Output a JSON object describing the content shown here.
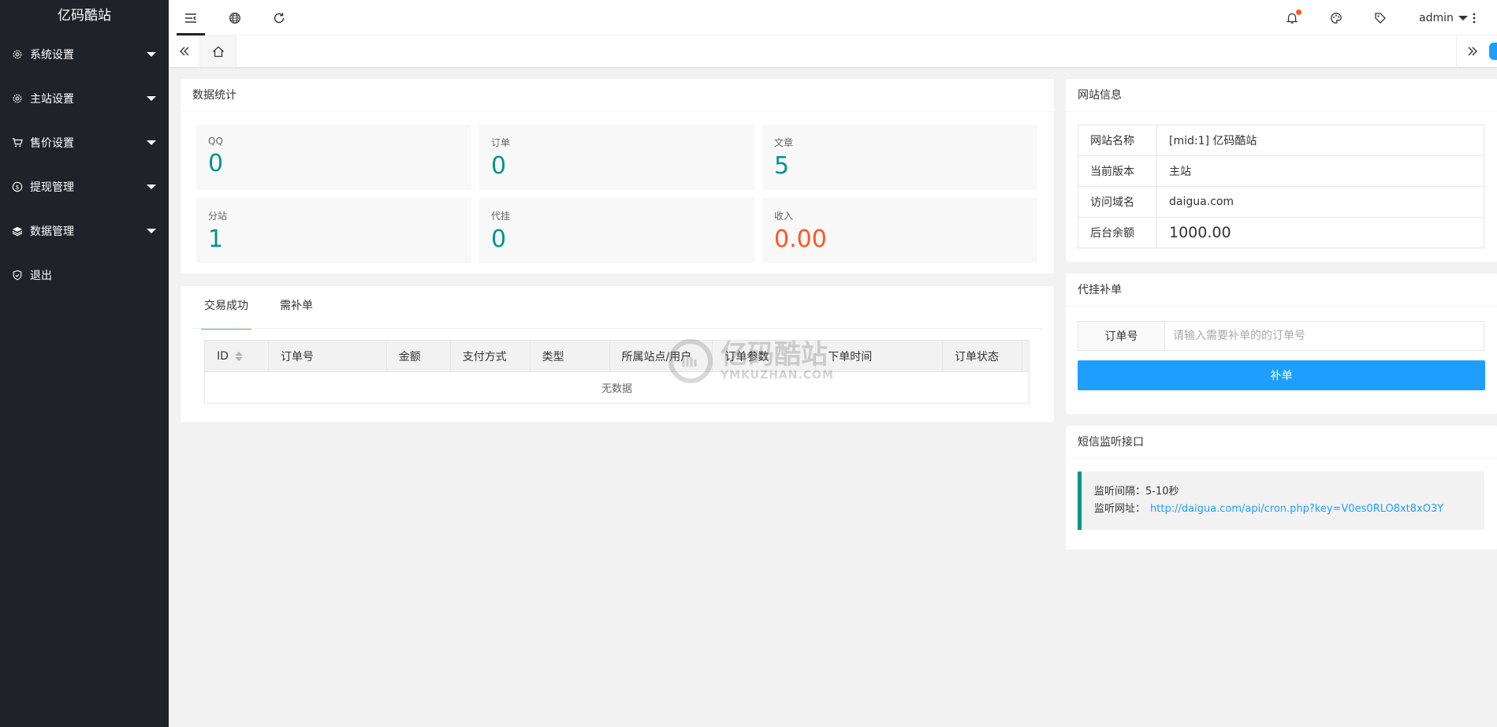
{
  "sidebar": {
    "logo": "亿码酷站",
    "items": [
      {
        "label": "系统设置",
        "icon": "gear-icon"
      },
      {
        "label": "主站设置",
        "icon": "gear-icon"
      },
      {
        "label": "售价设置",
        "icon": "cart-icon"
      },
      {
        "label": "提现管理",
        "icon": "dollar-icon"
      },
      {
        "label": "数据管理",
        "icon": "layers-icon"
      },
      {
        "label": "退出",
        "icon": "shield-icon"
      }
    ]
  },
  "header": {
    "user": "admin"
  },
  "stats_card": {
    "title": "数据统计",
    "items": [
      {
        "label": "QQ",
        "value": "0"
      },
      {
        "label": "订单",
        "value": "0"
      },
      {
        "label": "文章",
        "value": "5"
      },
      {
        "label": "分站",
        "value": "1"
      },
      {
        "label": "代挂",
        "value": "0"
      },
      {
        "label": "收入",
        "value": "0.00"
      }
    ]
  },
  "orders_card": {
    "tabs": [
      "交易成功",
      "需补单"
    ],
    "columns": [
      "ID",
      "订单号",
      "金额",
      "支付方式",
      "类型",
      "所属站点/用户",
      "订单参数",
      "下单时间",
      "订单状态"
    ],
    "empty_text": "无数据"
  },
  "watermark": {
    "cn": "亿码酷站",
    "en": "YMKUZHAN.COM"
  },
  "site_info": {
    "title": "网站信息",
    "rows": [
      {
        "key": "网站名称",
        "value": "[mid:1] 亿码酷站"
      },
      {
        "key": "当前版本",
        "value": "主站"
      },
      {
        "key": "访问域名",
        "value": "daigua.com"
      },
      {
        "key": "后台余额",
        "value": "1000.00"
      }
    ]
  },
  "supplement": {
    "title": "代挂补单",
    "label": "订单号",
    "placeholder": "请输入需要补单的的订单号",
    "button": "补单"
  },
  "sms": {
    "title": "短信监听接口",
    "interval_label": "监听间隔：",
    "interval_value": "5-10秒",
    "url_label": "监听网址：",
    "url_value": "http://daigua.com/api/cron.php?key=V0es0RLO8xt8xO3Y"
  },
  "colors": {
    "sidebar_bg": "#20222a",
    "teal": "#009688",
    "orange": "#ff5722",
    "blue": "#1e9fff",
    "green_tab": "#5fb878"
  }
}
